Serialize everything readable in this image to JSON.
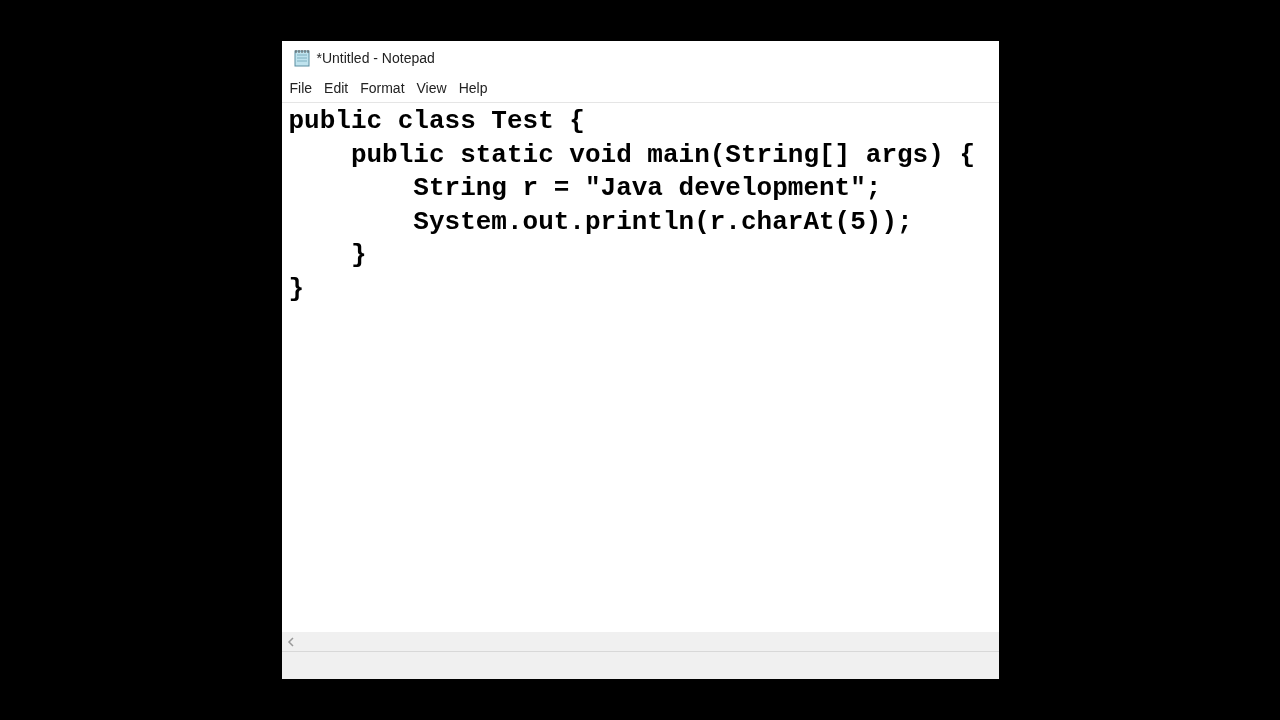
{
  "window": {
    "title": "*Untitled - Notepad"
  },
  "menu": [
    "File",
    "Edit",
    "Format",
    "View",
    "Help"
  ],
  "editor": {
    "lines": [
      "public class Test {",
      "    public static void main(String[] args) {",
      "        String r = \"Java development\";",
      "        System.out.println(r.charAt(5));",
      "    }",
      "}"
    ]
  }
}
